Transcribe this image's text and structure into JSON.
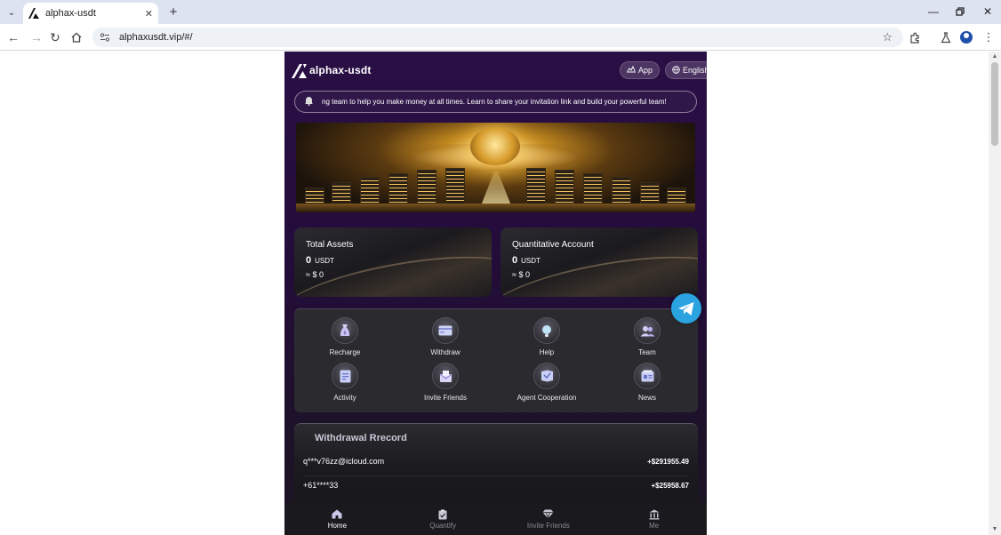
{
  "browser": {
    "tab_title": "alphax-usdt",
    "url": "alphaxusdt.vip/#/"
  },
  "app": {
    "brand": "alphax-usdt",
    "app_button": "App",
    "language_button": "English",
    "notice": "ng team to help you make money at all times. Learn to share your invitation link and build your powerful team!",
    "assets": [
      {
        "label": "Total Assets",
        "amount": "0",
        "unit": "USDT",
        "approx": "≈ $ 0"
      },
      {
        "label": "Quantitative Account",
        "amount": "0",
        "unit": "USDT",
        "approx": "≈ $ 0"
      }
    ],
    "menu": [
      {
        "label": "Recharge",
        "icon": "recharge-icon"
      },
      {
        "label": "Withdraw",
        "icon": "withdraw-icon"
      },
      {
        "label": "Help",
        "icon": "help-icon"
      },
      {
        "label": "Team",
        "icon": "team-icon"
      },
      {
        "label": "Activity",
        "icon": "activity-icon"
      },
      {
        "label": "Invite Friends",
        "icon": "invite-friends-icon"
      },
      {
        "label": "Agent Cooperation",
        "icon": "agent-cooperation-icon"
      },
      {
        "label": "News",
        "icon": "news-icon"
      }
    ],
    "withdrawal": {
      "title": "Withdrawal Rrecord",
      "rows": [
        {
          "user": "q***v76zz@icloud.com",
          "amount": "+$291955.49"
        },
        {
          "user": "+61****33",
          "amount": "+$25958.67"
        }
      ]
    },
    "bottom_nav": [
      {
        "label": "Home",
        "icon": "home-icon",
        "active": true
      },
      {
        "label": "Quantify",
        "icon": "clipboard-icon",
        "active": false
      },
      {
        "label": "Invite Friends",
        "icon": "diamond-icon",
        "active": false
      },
      {
        "label": "Me",
        "icon": "bank-icon",
        "active": false
      }
    ]
  },
  "colors": {
    "app_background": "#2a0f45",
    "telegram": "#2aa3e0",
    "browser_tabbar": "#dde3f1"
  }
}
